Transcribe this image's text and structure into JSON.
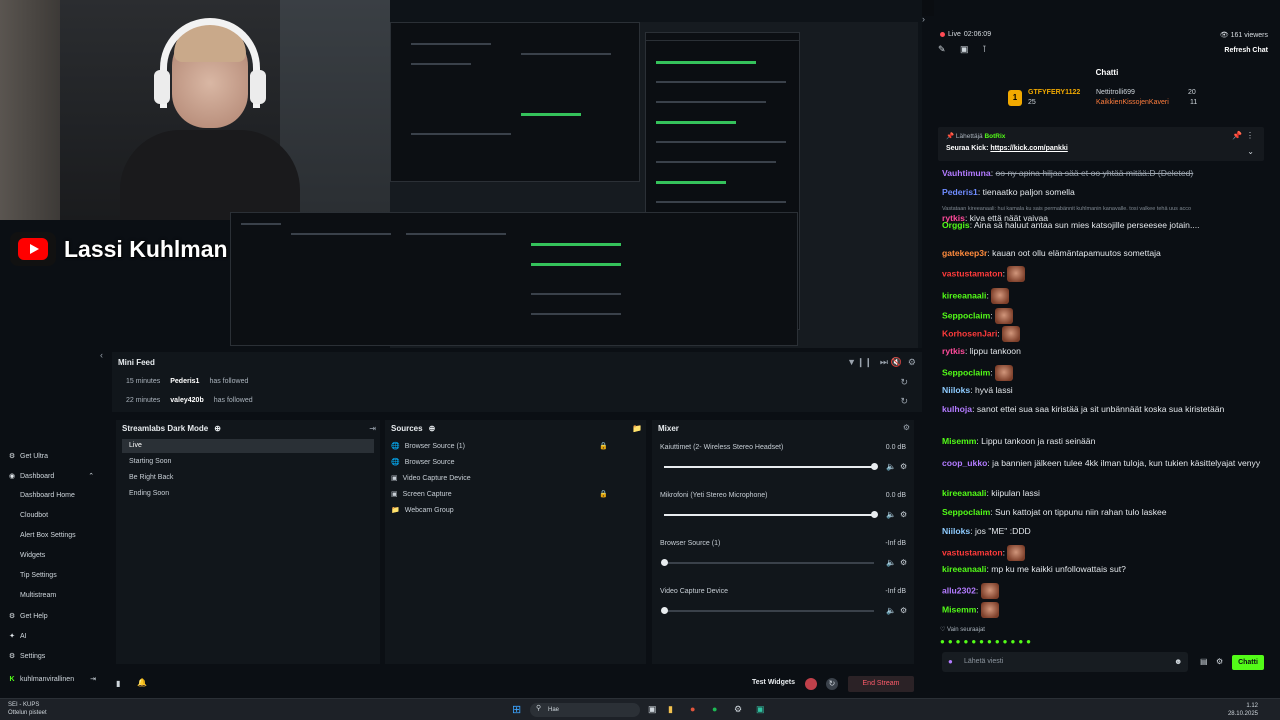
{
  "branding": {
    "channel_name": "Lassi Kuhlman"
  },
  "mini_feed": {
    "title": "Mini Feed",
    "rows": [
      {
        "time": "15 minutes",
        "user": "Pederis1",
        "action": "has followed"
      },
      {
        "time": "22 minutes",
        "user": "valey420b",
        "action": "has followed"
      }
    ]
  },
  "nav": {
    "items": [
      {
        "label": "Get Ultra",
        "icon": "ultra-icon"
      },
      {
        "label": "Dashboard",
        "icon": "dashboard-icon"
      },
      {
        "label": "Dashboard Home",
        "sub": true
      },
      {
        "label": "Cloudbot",
        "sub": true
      },
      {
        "label": "Alert Box Settings",
        "sub": true
      },
      {
        "label": "Widgets",
        "sub": true
      },
      {
        "label": "Tip Settings",
        "sub": true
      },
      {
        "label": "Multistream",
        "sub": true
      },
      {
        "label": "Get Help",
        "icon": "help-icon"
      },
      {
        "label": "AI",
        "icon": "ai-icon"
      },
      {
        "label": "Settings",
        "icon": "gear-icon"
      },
      {
        "label": "kuhlmanvirallinen",
        "icon": "kick-icon"
      }
    ]
  },
  "scenes": {
    "title": "Streamlabs Dark Mode",
    "items": [
      "Live",
      "Starting Soon",
      "Be Right Back",
      "Ending Soon"
    ]
  },
  "sources": {
    "title": "Sources",
    "items": [
      "Browser Source (1)",
      "Browser Source",
      "Video Capture Device",
      "Screen Capture",
      "Webcam Group"
    ]
  },
  "mixer": {
    "title": "Mixer",
    "items": [
      {
        "name": "Kaiuttimet (2- Wireless Stereo Headset)",
        "db": "0.0 dB",
        "level": 1.0
      },
      {
        "name": "Mikrofoni (Yeti Stereo Microphone)",
        "db": "0.0 dB",
        "level": 1.0
      },
      {
        "name": "Browser Source (1)",
        "db": "-Inf dB",
        "level": 0.0
      },
      {
        "name": "Video Capture Device",
        "db": "-Inf dB",
        "level": 0.0
      }
    ]
  },
  "status": {
    "test_widgets": "Test Widgets",
    "end_stream": "End Stream"
  },
  "chat": {
    "live_label": "Live",
    "uptime": "02:06:09",
    "viewers": "161 viewers",
    "refresh": "Refresh Chat",
    "title": "Chatti",
    "leaders": [
      {
        "rank": "1",
        "name": "GTFYFERY1122",
        "count": "25"
      },
      {
        "rank": "",
        "name": "Nettitrolli699",
        "count": "20"
      },
      {
        "rank": "",
        "name": "KaikkienKissojenKaveri",
        "count": "11"
      }
    ],
    "pinned": {
      "sender_label": "Lähettäjä",
      "sender": "BotRix",
      "text": "Seuraa Kick:",
      "link": "https://kick.com/pankki"
    },
    "messages": [
      {
        "user": "Vauhtimuna",
        "color": "#b37bff",
        "text": "oo ny apina hiljaa sää et oo yhtää mitää:D (Deleted)",
        "deleted": true
      },
      {
        "user": "Pederis1",
        "color": "#6f8cff",
        "text": "tienaatko paljon somella"
      },
      {
        "user": "rytkis",
        "color": "#ff4b9b",
        "text": "kiva että näät vaivaa",
        "reply": "Vastataan kireeanaali: hui kamala ku sais permabännit kuhlmanin kanavalle. tosi valkee tehä uus acco"
      },
      {
        "user": "Orggis",
        "color": "#53fc18",
        "text": "Aina sä haluut antaa sun mies katsojille perseesee jotain...."
      },
      {
        "user": "gatekeep3r",
        "color": "#ff8b3d",
        "text": "kauan oot ollu elämäntapamuutos somettaja"
      },
      {
        "user": "vastustamaton",
        "color": "#ff3b3b",
        "text": "",
        "emote": true
      },
      {
        "user": "kireeanaali",
        "color": "#53fc18",
        "text": "",
        "emote": true
      },
      {
        "user": "Seppoclaim",
        "color": "#53fc18",
        "text": "",
        "emote": true
      },
      {
        "user": "KorhosenJari",
        "color": "#ff3b3b",
        "text": "",
        "emote": true
      },
      {
        "user": "rytkis",
        "color": "#ff4b9b",
        "text": "lippu tankoon"
      },
      {
        "user": "Seppoclaim",
        "color": "#53fc18",
        "text": "",
        "emote": true
      },
      {
        "user": "Niiloks",
        "color": "#8ecbff",
        "text": "hyvä lassi"
      },
      {
        "user": "kulhoja",
        "color": "#b37bff",
        "text": "sanot ettei sua saa kiristää ja sit unbännäät koska sua kiristetään"
      },
      {
        "user": "Misemm",
        "color": "#53fc18",
        "text": "Lippu tankoon ja rasti seinään"
      },
      {
        "user": "coop_ukko",
        "color": "#b37bff",
        "text": "ja bannien jälkeen tulee 4kk ilman tuloja, kun tukien käsittelyajat venyy"
      },
      {
        "user": "kireeanaali",
        "color": "#53fc18",
        "text": "kiipulan lassi"
      },
      {
        "user": "Seppoclaim",
        "color": "#53fc18",
        "text": "Sun kattojat on tippunu niin rahan tulo laskee"
      },
      {
        "user": "Niiloks",
        "color": "#8ecbff",
        "text": "jos \"ME\" :DDD"
      },
      {
        "user": "vastustamaton",
        "color": "#ff3b3b",
        "text": "",
        "emote": true
      },
      {
        "user": "kireeanaali",
        "color": "#53fc18",
        "text": "mp ku me kaikki unfollowattais sut?"
      },
      {
        "user": "allu2302",
        "color": "#b37bff",
        "text": "",
        "emote": true
      },
      {
        "user": "Misemm",
        "color": "#53fc18",
        "text": "",
        "emote": true
      }
    ],
    "followers_only": "Vain seuraajat",
    "input_placeholder": "Lähetä viesti",
    "send_label": "Chatti"
  },
  "taskbar": {
    "weather_line1": "SEI - KUPS",
    "weather_line2": "Ottelun pisteet",
    "search_placeholder": "Hae",
    "time": "1.12",
    "date": "28.10.2025"
  }
}
